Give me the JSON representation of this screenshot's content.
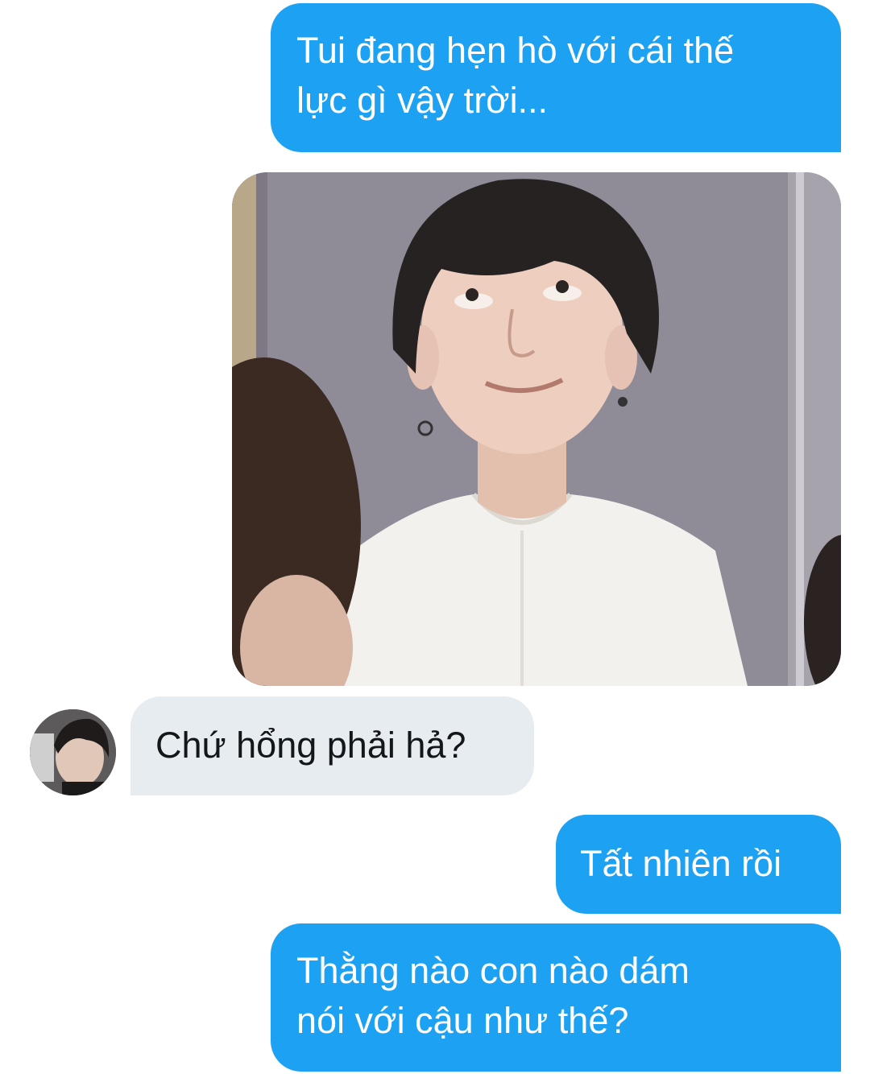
{
  "messages": [
    {
      "direction": "outgoing",
      "lines": [
        "Tui đang hẹn hò với cái thế",
        "lực gì vậy trời..."
      ]
    },
    {
      "direction": "outgoing",
      "type": "image"
    },
    {
      "direction": "incoming",
      "lines": [
        "Chứ hổng phải hả?"
      ]
    },
    {
      "direction": "outgoing",
      "lines": [
        "Tất nhiên rồi"
      ]
    },
    {
      "direction": "outgoing",
      "lines": [
        "Thằng nào con nào dám",
        "nói với cậu như thế?"
      ]
    }
  ],
  "colors": {
    "outgoing_bubble": "#1da1f2",
    "incoming_bubble": "#e6ecf0",
    "outgoing_text": "#ffffff",
    "incoming_text": "#14171a"
  }
}
